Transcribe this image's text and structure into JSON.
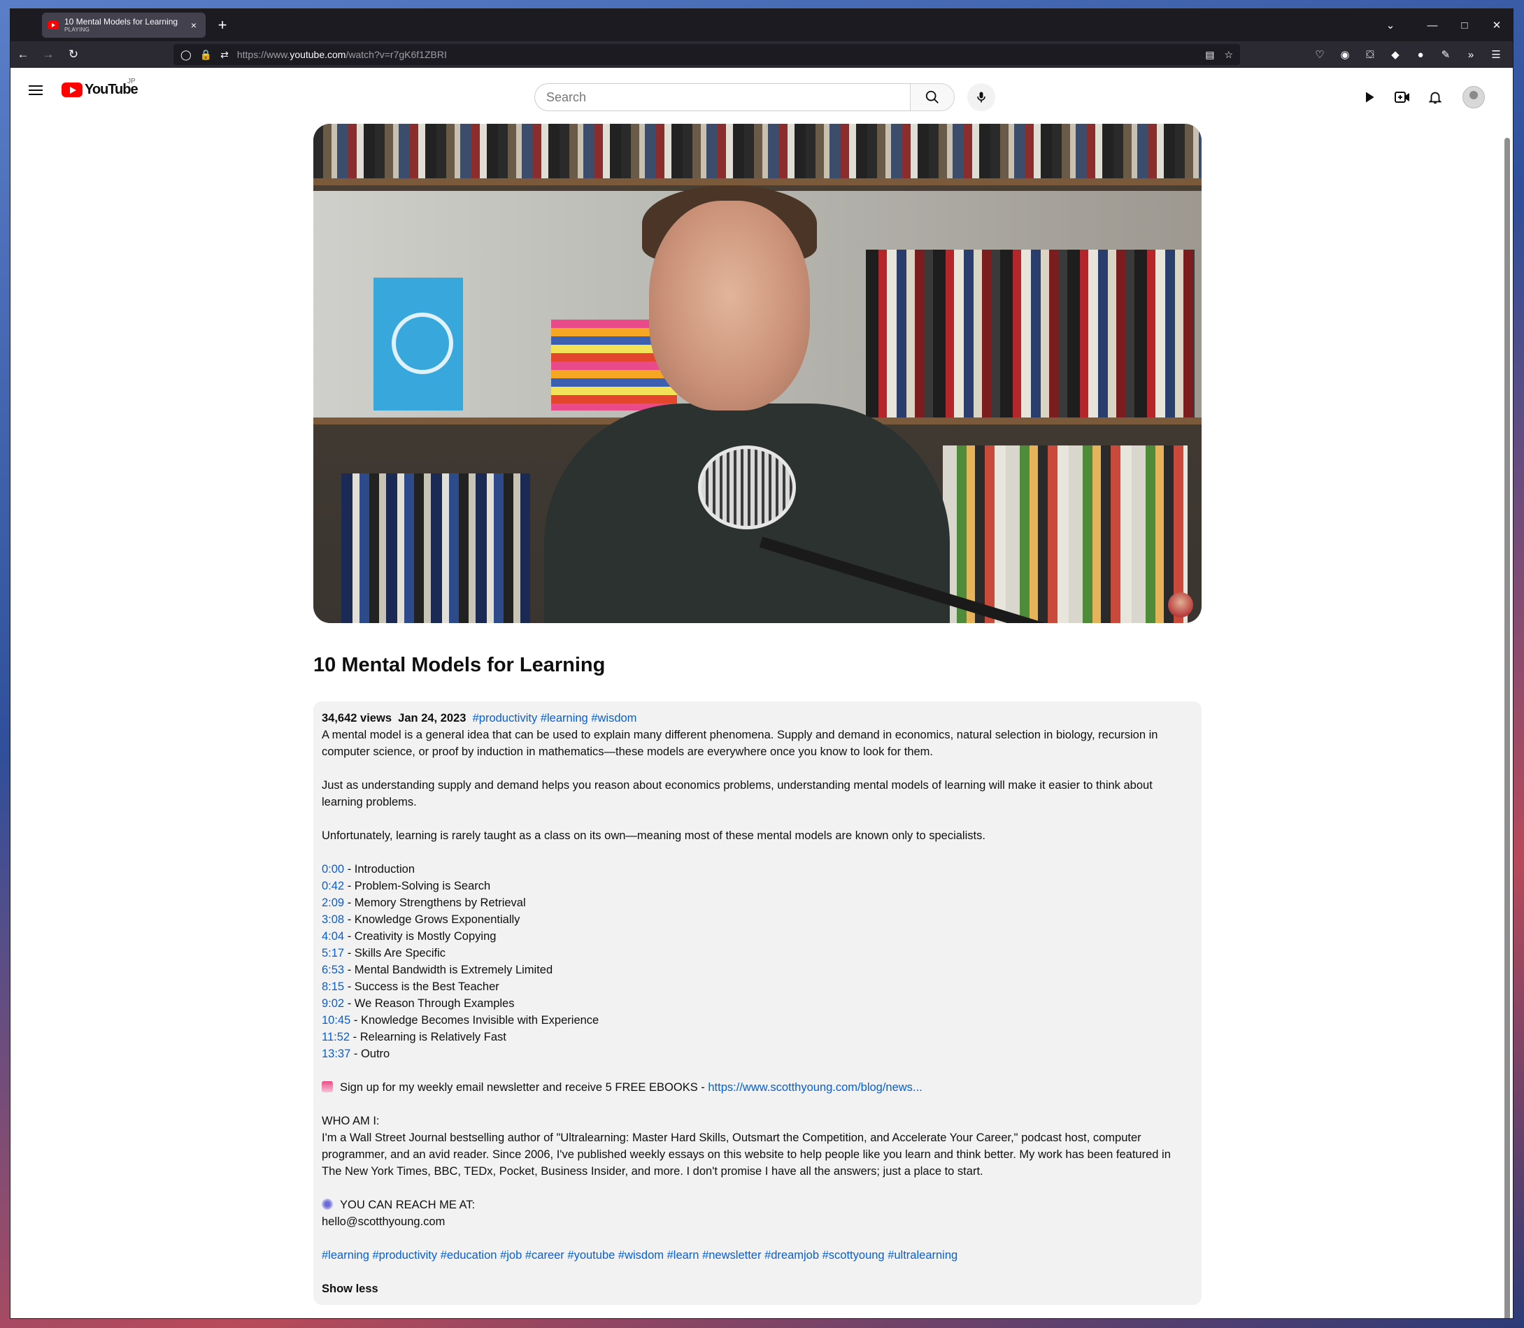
{
  "browser": {
    "tab": {
      "title": "10 Mental Models for Learning",
      "subtitle": "PLAYING",
      "close": "×"
    },
    "new_tab": "+",
    "url": {
      "prefix": "https://www.",
      "domain": "youtube.com",
      "path": "/watch?v=r7gK6f1ZBRI"
    }
  },
  "youtube": {
    "logo_text": "YouTube",
    "country": "JP",
    "search": {
      "placeholder": "Search"
    }
  },
  "video": {
    "title": "10 Mental Models for Learning"
  },
  "description": {
    "views": "34,642 views",
    "date": "Jan 24, 2023",
    "top_tags": [
      "#productivity",
      "#learning",
      "#wisdom"
    ],
    "para1": "A mental model is a general idea that can be used to explain many different phenomena. Supply and demand in economics, natural selection in biology, recursion in computer science, or proof by induction in mathematics—these models are everywhere once you know to look for them.",
    "para2": "Just as understanding supply and demand helps you reason about economics problems, understanding mental models of learning will make it easier to think about learning problems.",
    "para3": "Unfortunately, learning is rarely taught as a class on its own—meaning most of these mental models are known only to specialists.",
    "chapters": [
      {
        "time": "0:00",
        "title": " - Introduction"
      },
      {
        "time": "0:42",
        "title": " - Problem-Solving is Search"
      },
      {
        "time": "2:09",
        "title": " - Memory Strengthens by Retrieval"
      },
      {
        "time": "3:08",
        "title": " - Knowledge Grows Exponentially"
      },
      {
        "time": "4:04",
        "title": " - Creativity is Mostly Copying"
      },
      {
        "time": "5:17",
        "title": " - Skills Are Specific"
      },
      {
        "time": "6:53",
        "title": " - Mental Bandwidth is Extremely Limited"
      },
      {
        "time": "8:15",
        "title": " - Success is the Best Teacher"
      },
      {
        "time": "9:02",
        "title": " - We Reason Through Examples"
      },
      {
        "time": "10:45",
        "title": " - Knowledge Becomes Invisible with Experience"
      },
      {
        "time": "11:52",
        "title": " - Relearning is Relatively Fast"
      },
      {
        "time": "13:37",
        "title": " - Outro"
      }
    ],
    "newsletter_text": "Sign up for my weekly email newsletter and receive 5 FREE EBOOKS - ",
    "newsletter_link": "https://www.scotthyoung.com/blog/news...",
    "who_heading": "WHO AM I:",
    "who_text": "I'm a Wall Street Journal bestselling author of \"Ultralearning: Master Hard Skills, Outsmart the Competition, and Accelerate Your Career,\" podcast host, computer programmer, and an avid reader. Since 2006, I've published weekly essays on this website to help people like you learn and think better. My work has been featured in The New York Times, BBC, TEDx, Pocket, Business Insider, and more. I don't promise I have all the answers; just a place to start.",
    "reach_heading": "YOU CAN REACH ME AT:",
    "email": "hello@scotthyoung.com",
    "bottom_tags": [
      "#learning",
      "#productivity",
      "#education",
      "#job",
      "#career",
      "#youtube",
      "#wisdom",
      "#learn",
      "#newsletter",
      "#dreamjob",
      "#scottyoung",
      "#ultralearning"
    ],
    "show_less": "Show less"
  },
  "colors": {
    "link": "#065fd4",
    "brand_red": "#ff0000",
    "description_bg": "#f2f2f2"
  }
}
